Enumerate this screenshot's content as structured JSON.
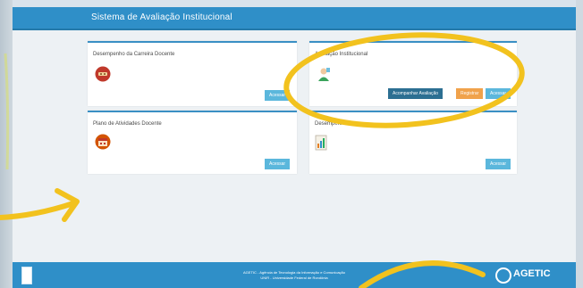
{
  "header": {
    "title": "Sistema de Avaliação Institucional"
  },
  "cards": [
    {
      "title": "Desempenho da Carreira Docente",
      "buttons": [
        "Acessar"
      ]
    },
    {
      "title": "Avaliação Institucional",
      "buttons": [
        "Acompanhar Avaliação",
        "Registrar",
        "Acessar"
      ]
    },
    {
      "title": "Plano de Atividades Docente",
      "buttons": [
        "Acessar"
      ]
    },
    {
      "title": "Desempenho",
      "buttons": [
        "Acessar"
      ]
    }
  ],
  "footer": {
    "line1": "AGETIC - Agência de Tecnologia da Informação e Comunicação",
    "line2": "UNIR - Universidade Federal de Rondônia",
    "brand": "AGETIC"
  },
  "colors": {
    "accent": "#2f8fc8",
    "button": "#5bb7dc",
    "button_dark": "#2c6f92",
    "button_warn": "#f0a24b",
    "annotation": "#f2c21e"
  },
  "icons": [
    "trophy-icon",
    "user-evaluation-icon",
    "calendar-icon",
    "document-chart-icon",
    "ifba-logo-icon",
    "agetic-logo-icon"
  ]
}
